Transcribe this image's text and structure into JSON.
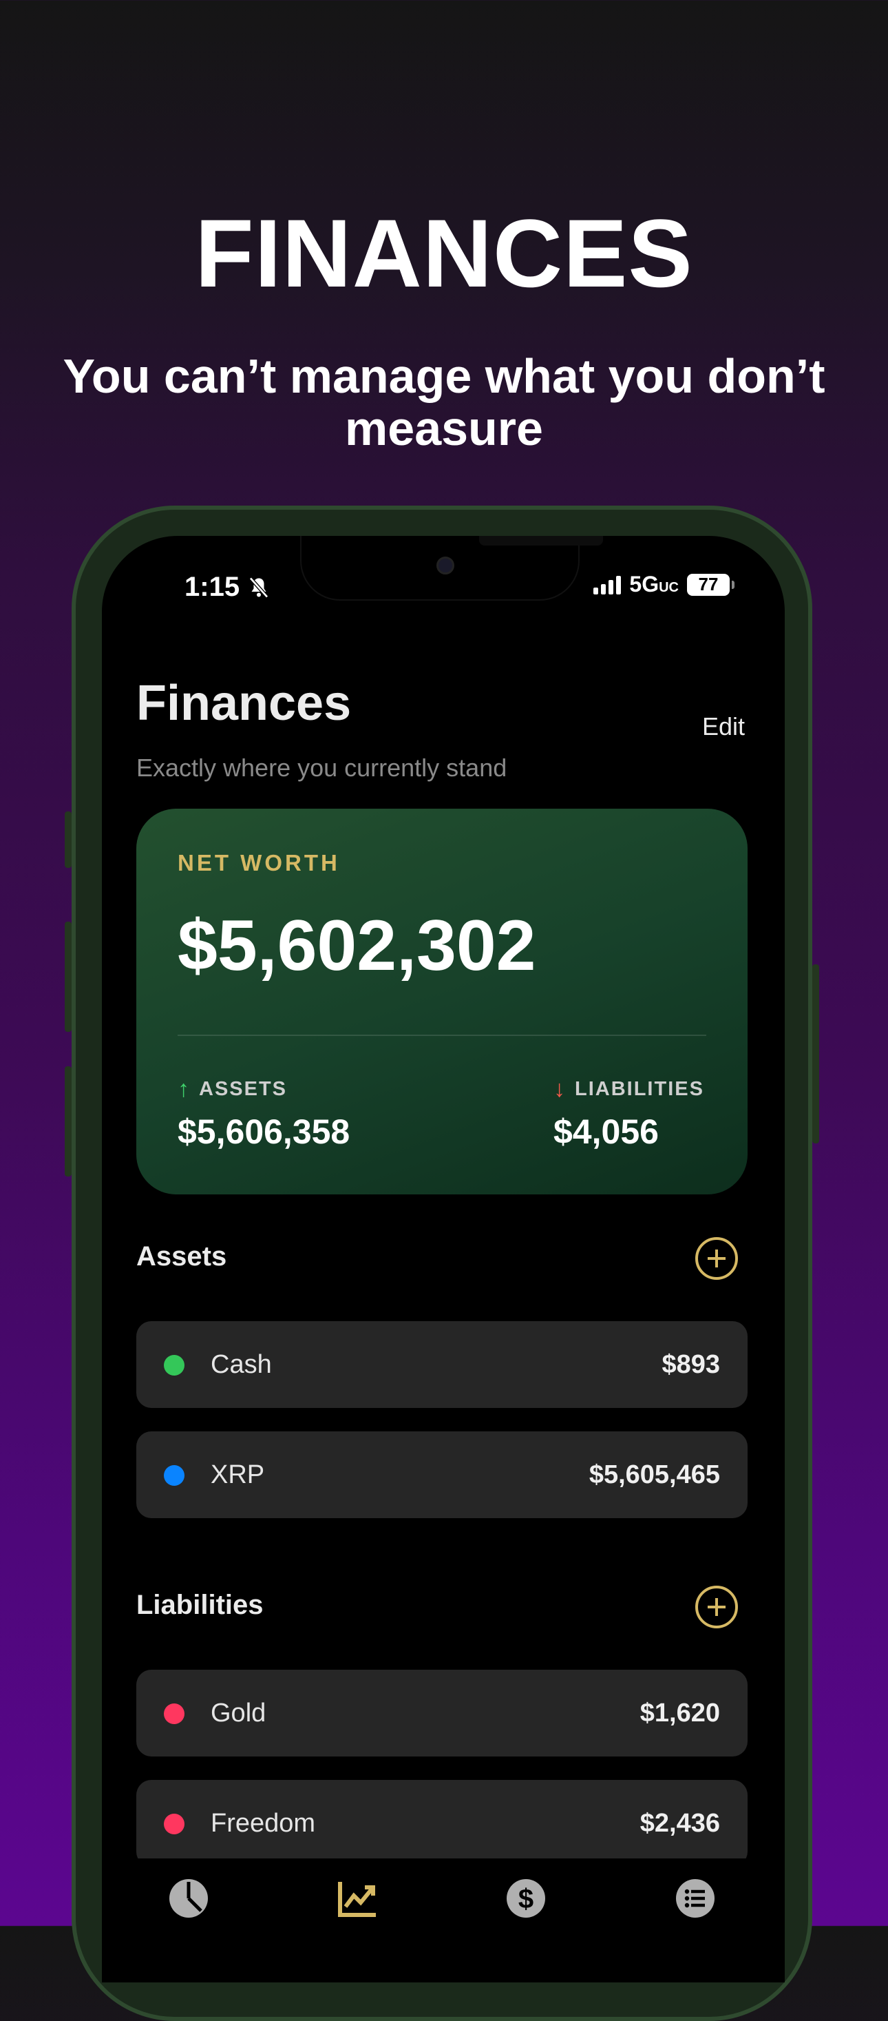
{
  "promo": {
    "title": "FINANCES",
    "subtitle": "You can’t manage what you don’t measure"
  },
  "status_bar": {
    "time": "1:15",
    "network": "5G",
    "network_suffix": "UC",
    "battery": "77"
  },
  "header": {
    "title": "Finances",
    "subtitle": "Exactly where you currently stand",
    "edit_label": "Edit"
  },
  "net_worth": {
    "label": "NET WORTH",
    "value": "$5,602,302",
    "assets_label": "ASSETS",
    "assets_value": "$5,606,358",
    "liabilities_label": "LIABILITIES",
    "liabilities_value": "$4,056"
  },
  "assets": {
    "title": "Assets",
    "items": [
      {
        "name": "Cash",
        "value": "$893",
        "color": "#34c759"
      },
      {
        "name": "XRP",
        "value": "$5,605,465",
        "color": "#0a84ff"
      }
    ]
  },
  "liabilities": {
    "title": "Liabilities",
    "items": [
      {
        "name": "Gold",
        "value": "$1,620",
        "color": "#ff375f"
      },
      {
        "name": "Freedom",
        "value": "$2,436",
        "color": "#ff375f"
      }
    ]
  },
  "tabs": [
    {
      "icon": "pie-chart-icon"
    },
    {
      "icon": "trend-chart-icon",
      "active": true
    },
    {
      "icon": "dollar-icon"
    },
    {
      "icon": "list-icon"
    }
  ],
  "colors": {
    "accent": "#d6b964",
    "card_green": "#17412a",
    "up": "#3fd06b",
    "down": "#f05a4a"
  }
}
